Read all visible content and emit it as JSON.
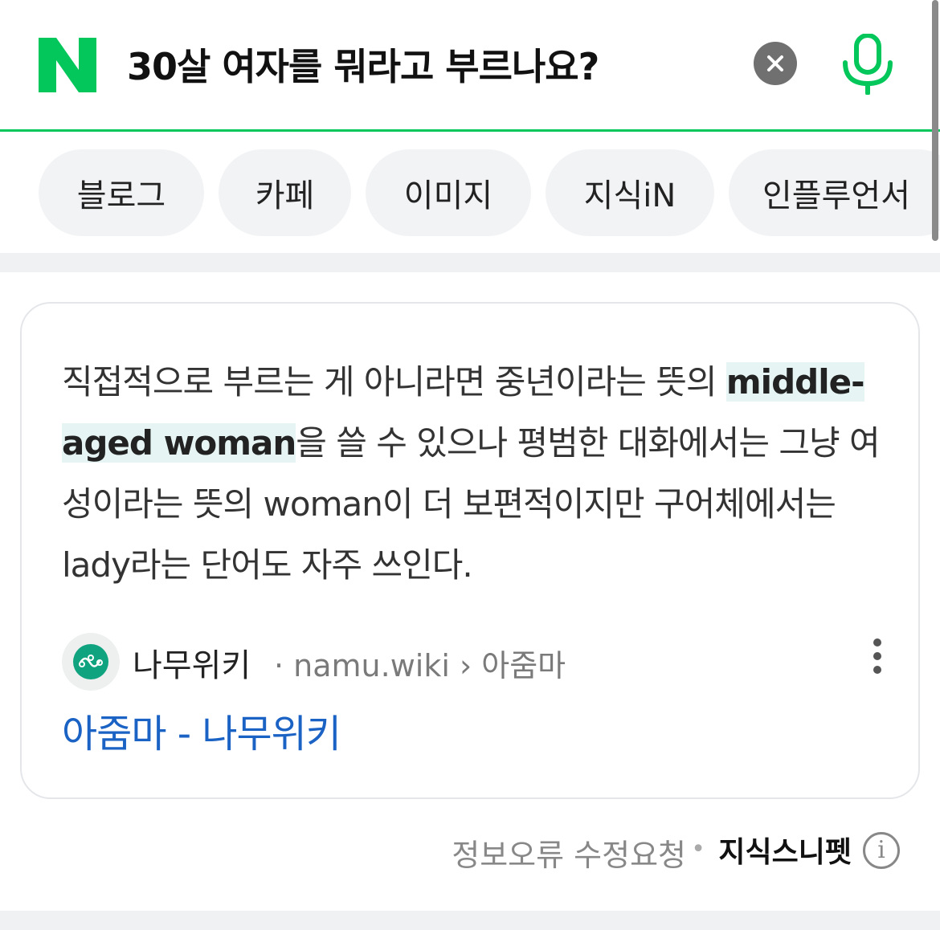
{
  "search": {
    "logo_letter": "N",
    "query": "30살 여자를 뭐라고 부르나요?",
    "clear_glyph": "×",
    "brand_color": "#03c75a"
  },
  "tabs": [
    {
      "label": "블로그"
    },
    {
      "label": "카페"
    },
    {
      "label": "이미지"
    },
    {
      "label": "지식iN"
    },
    {
      "label": "인플루언서"
    }
  ],
  "snippet": {
    "text_before": "직접적으로 부르는 게 아니라면 중년이라는 뜻의 ",
    "highlight": "middle-aged woman",
    "text_after": "을 쓸 수 있으나 평범한 대화에서는 그냥 여성이라는 뜻의 woman이 더 보편적이지만 구어체에서는 lady라는 단어도 자주 쓰인다.",
    "source": {
      "name": "나무위키",
      "path": "· namu.wiki › 아줌마",
      "icon": "namu-wiki-logo-icon"
    },
    "title": "아줌마 - 나무위키",
    "highlight_color": "#e6f5f4",
    "link_color": "#1a62c4"
  },
  "footer": {
    "report": "정보오류 수정요청",
    "dot": "•",
    "brand": "지식스니펫",
    "info_glyph": "i"
  }
}
